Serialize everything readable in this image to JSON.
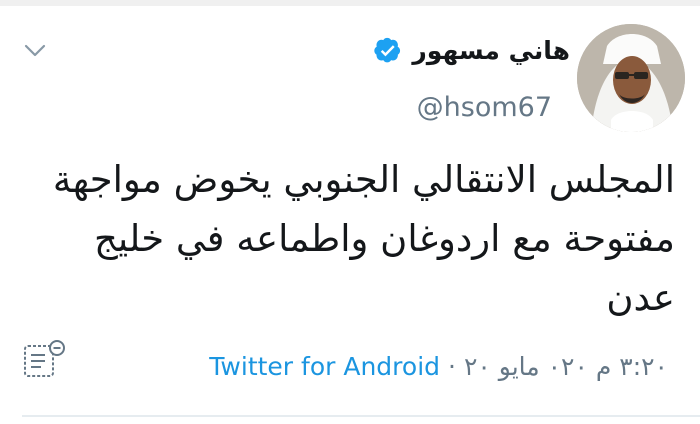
{
  "tweet": {
    "author": {
      "name": "هاني مسهور",
      "handle": "@hsom67",
      "verified_icon": "verified-badge-icon"
    },
    "text_lines": [
      "المجلس الانتقالي الجنوبي يخوض مواجهة",
      "مفتوحة مع اردوغان واطماعه في خليج",
      "عدن"
    ],
    "timestamp": "٣:٢٠ م ٠٢٠ مايو ٢٠",
    "separator": "·",
    "source": "Twitter for Android",
    "icons": {
      "menu": "chevron-down-icon",
      "analytics": "analytics-icon"
    },
    "colors": {
      "link": "#1b95e0",
      "muted": "#657786",
      "text": "#14171a",
      "verified": "#1da1f2"
    }
  }
}
